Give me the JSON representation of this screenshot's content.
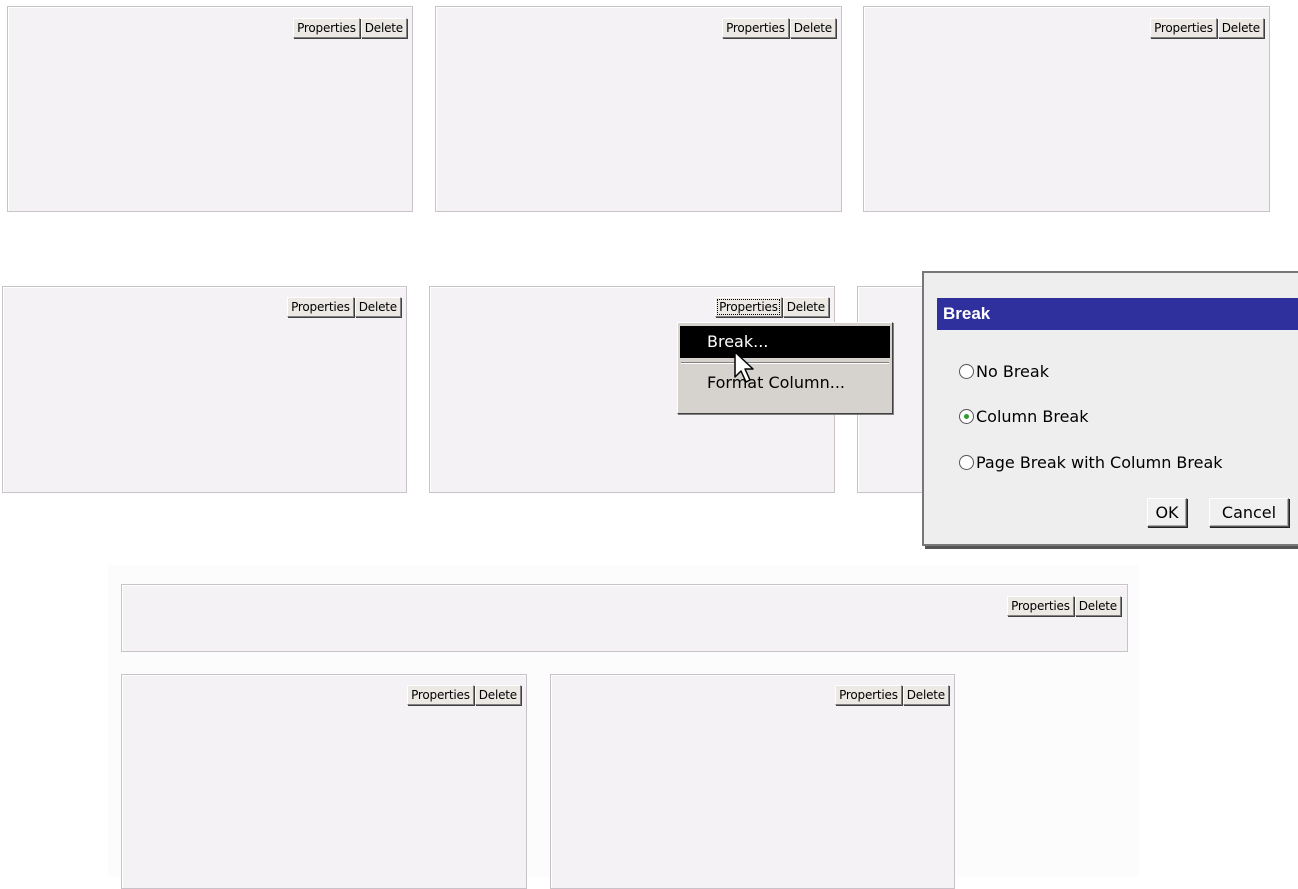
{
  "panel_buttons": {
    "properties_label": "Properties",
    "delete_label": "Delete"
  },
  "context_menu": {
    "items": [
      {
        "label": "Break...",
        "selected": true
      },
      {
        "label": "Format Column...",
        "selected": false
      }
    ]
  },
  "break_dialog": {
    "title": "Break",
    "options": [
      {
        "label": "No Break",
        "checked": false
      },
      {
        "label": "Column Break",
        "checked": true
      },
      {
        "label": "Page Break with Column Break",
        "checked": false
      }
    ],
    "ok_label": "OK",
    "cancel_label": "Cancel"
  },
  "colors": {
    "panel_bg": "#f5f2f5",
    "panel_border": "#c9c3c9",
    "dialog_title_bg": "#2f2f9e",
    "radio_dot": "#2e9d2e",
    "menu_highlight": "#000000"
  }
}
